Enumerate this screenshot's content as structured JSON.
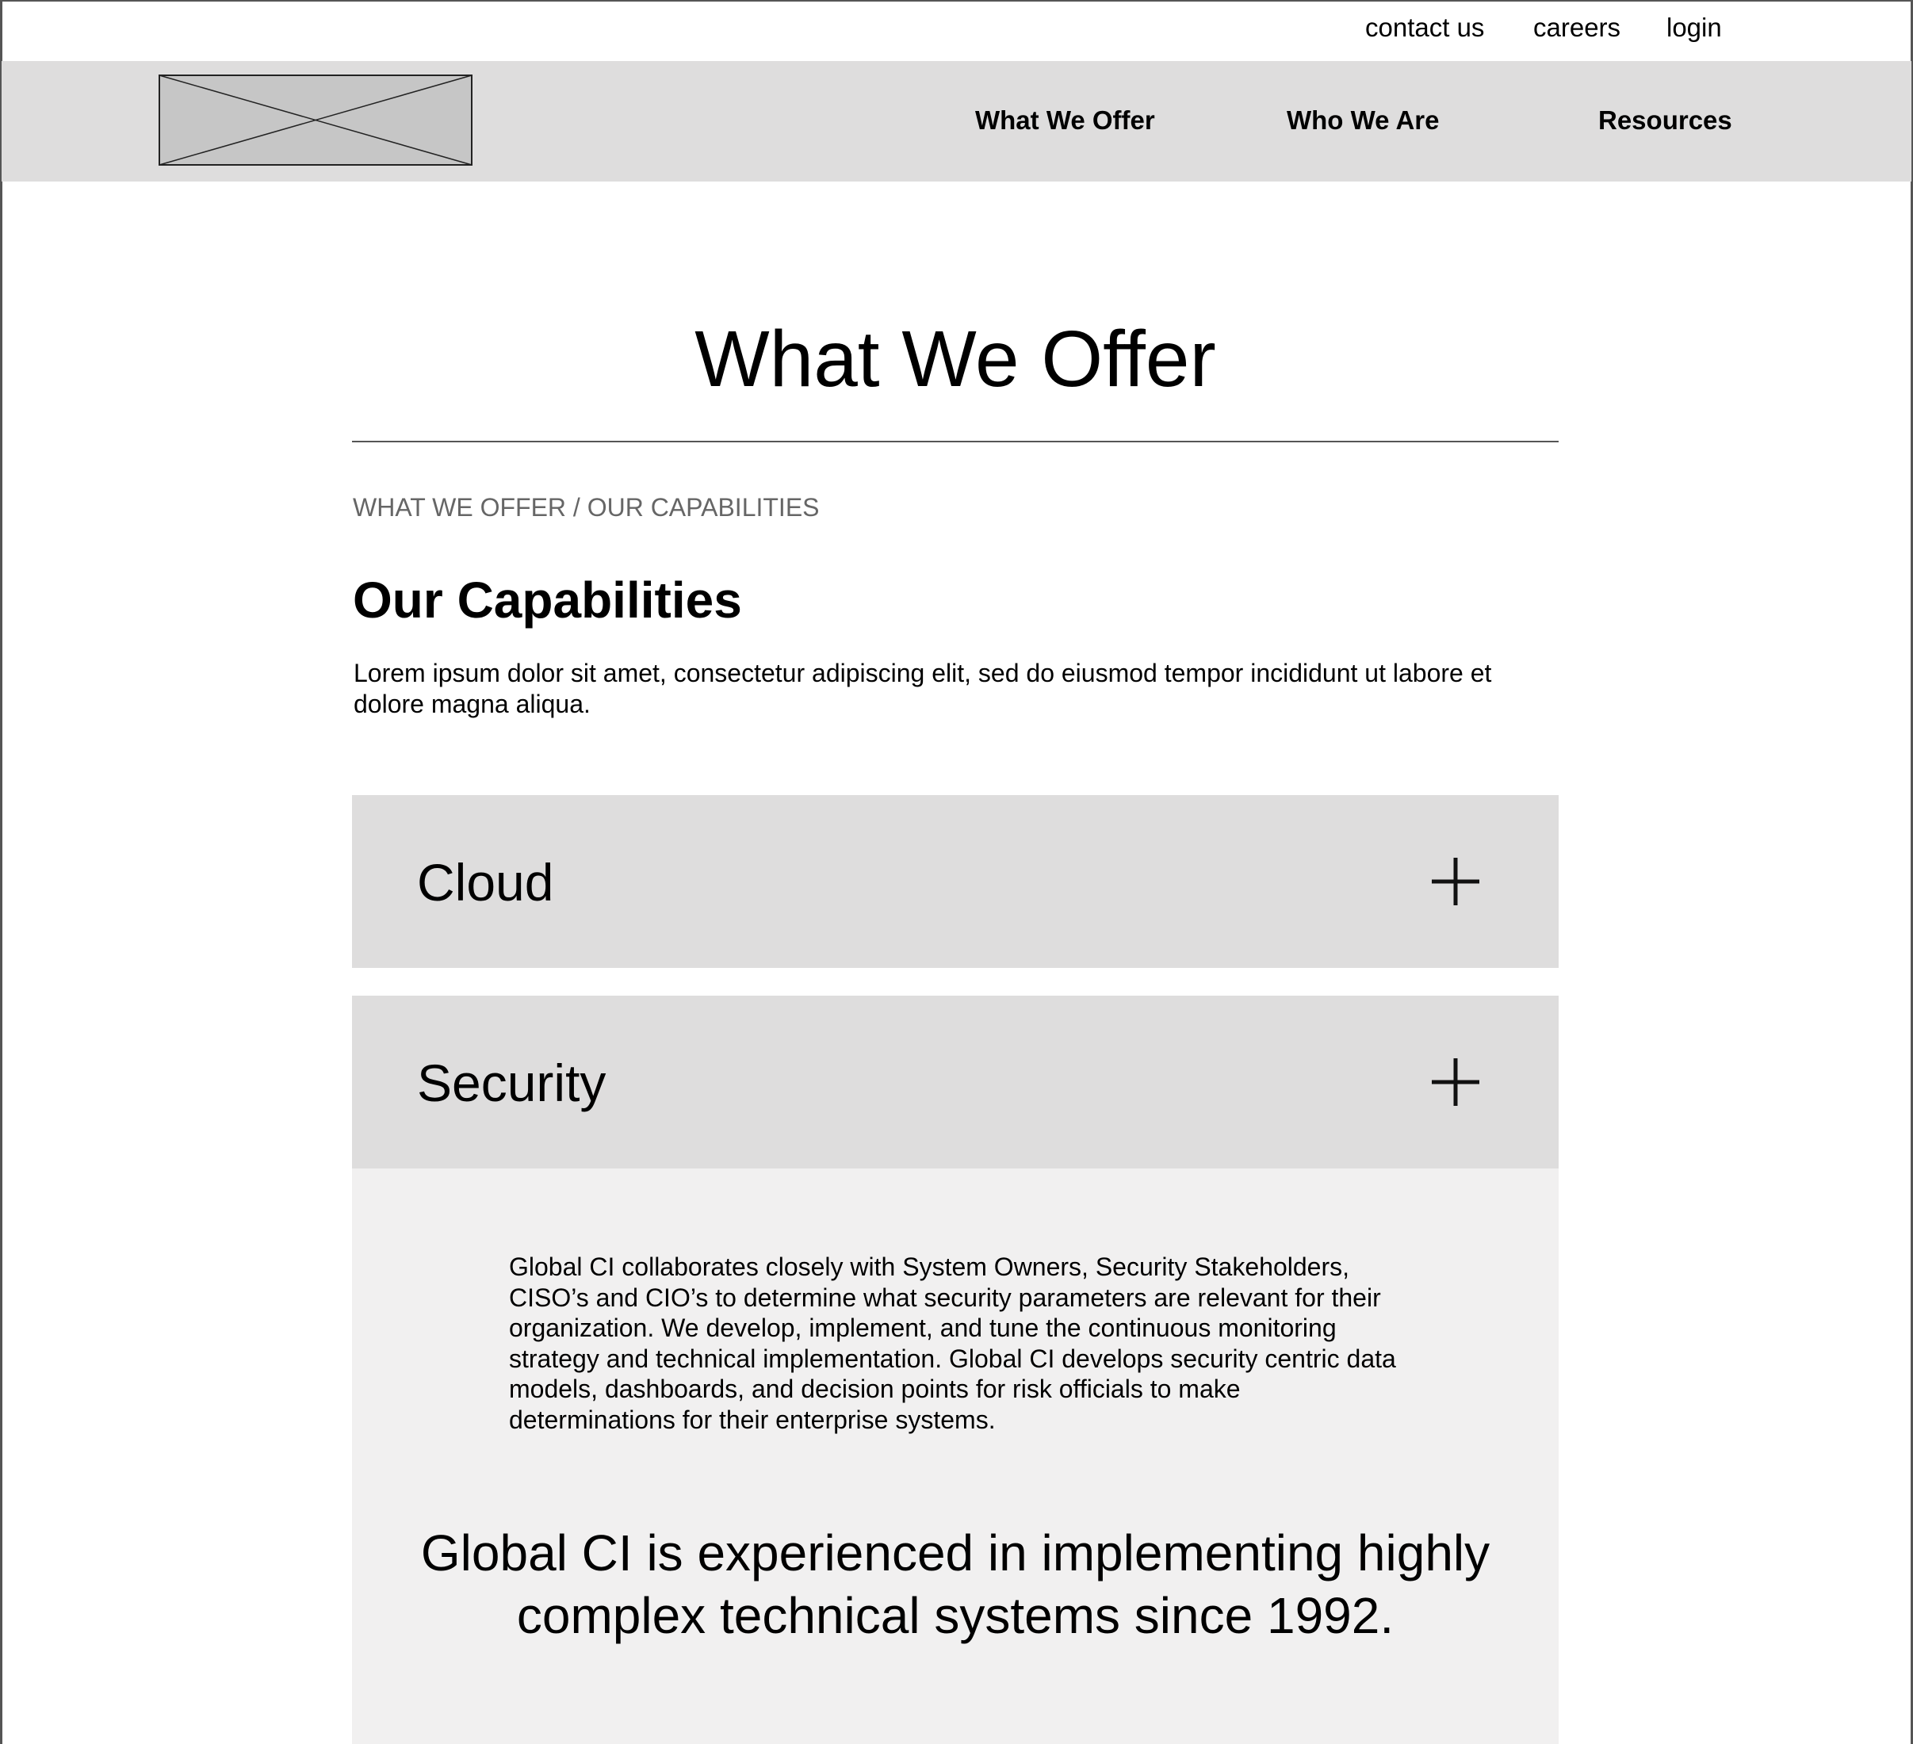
{
  "utility_nav": {
    "contact": "contact us",
    "careers": "careers",
    "login": "login"
  },
  "logo": {
    "icon": "image-placeholder-icon"
  },
  "main_nav": {
    "what_we_offer": "What We Offer",
    "who_we_are": "Who We Are",
    "resources": "Resources"
  },
  "page": {
    "title": "What We Offer",
    "breadcrumb": {
      "level1": "WHAT WE OFFER",
      "separator": " / ",
      "level2": "OUR CAPABILITIES"
    },
    "heading": "Our Capabilities",
    "intro": "Lorem ipsum dolor sit amet, consectetur adipiscing elit, sed do eiusmod tempor incididunt ut labore et dolore magna aliqua."
  },
  "accordion": {
    "items": [
      {
        "title": "Cloud",
        "icon": "plus-icon",
        "expanded": false
      },
      {
        "title": "Security",
        "icon": "plus-icon",
        "expanded": true,
        "body": "Global CI collaborates closely with System Owners, Security Stakeholders, CISO’s and CIO’s to determine what security parameters are relevant for their organization. We develop, implement, and tune the continuous monitoring strategy and technical implementation. Global CI develops security centric data models, dashboards, and decision points for risk officials to make determinations for their enterprise systems.",
        "callout": "Global CI is experienced in implementing highly complex technical systems since 1992."
      }
    ]
  },
  "colors": {
    "header_bg": "#dedddd",
    "accordion_header_bg": "#dedddd",
    "accordion_body_bg": "#f1f0f0",
    "breadcrumb_text": "#666666",
    "divider": "#555555"
  }
}
